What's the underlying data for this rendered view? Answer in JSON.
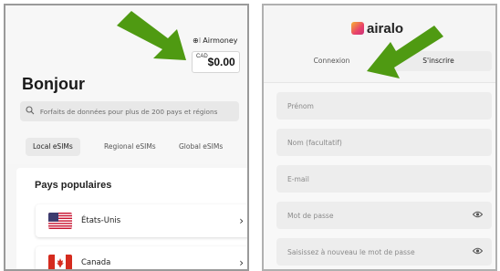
{
  "left_panel": {
    "airmoney": {
      "icon": "wallet-icon",
      "label": "Airmoney"
    },
    "balance": {
      "currency": "CAD",
      "amount": "$0.00"
    },
    "greeting": "Bonjour",
    "search": {
      "placeholder": "Forfaits de données pour plus de 200 pays et régions"
    },
    "tabs": [
      "Local eSIMs",
      "Regional eSIMs",
      "Global eSIMs"
    ],
    "active_tab": "Local eSIMs",
    "popular": {
      "title": "Pays populaires",
      "countries": [
        {
          "name": "États-Unis",
          "flag": "us-flag-icon"
        },
        {
          "name": "Canada",
          "flag": "canada-flag-icon"
        }
      ]
    }
  },
  "right_panel": {
    "logo_text": "airalo",
    "tabs": [
      "Connexion",
      "S'inscrire"
    ],
    "active_tab": "S'inscrire",
    "fields": [
      {
        "placeholder": "Prénom"
      },
      {
        "placeholder": "Nom (facultatif)"
      },
      {
        "placeholder": "E-mail"
      },
      {
        "placeholder": "Mot de passe",
        "icon": "eye-icon"
      },
      {
        "placeholder": "Saisissez à nouveau le mot de passe",
        "icon": "eye-icon"
      }
    ]
  },
  "annotations": {
    "arrow_color": "#4f9a12"
  }
}
